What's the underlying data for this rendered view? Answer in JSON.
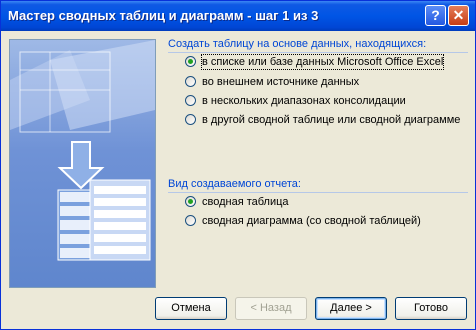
{
  "window": {
    "title": "Мастер сводных таблиц и диаграмм - шаг 1 из 3"
  },
  "titlebar_buttons": {
    "help": "?",
    "close": "✕"
  },
  "data_source": {
    "label": "Создать таблицу на основе данных, находящихся:",
    "options": [
      {
        "label": "в списке или базе данных Microsoft Office Excel",
        "selected": true
      },
      {
        "label": "во внешнем источнике данных",
        "selected": false
      },
      {
        "label": "в нескольких диапазонах консолидации",
        "selected": false
      },
      {
        "label": "в другой сводной таблице или сводной диаграмме",
        "selected": false
      }
    ]
  },
  "report_type": {
    "label": "Вид создаваемого отчета:",
    "options": [
      {
        "label": "сводная таблица",
        "selected": true
      },
      {
        "label": "сводная диаграмма (со сводной таблицей)",
        "selected": false
      }
    ]
  },
  "buttons": {
    "cancel": "Отмена",
    "back": "< Назад",
    "next": "Далее >",
    "finish": "Готово"
  }
}
